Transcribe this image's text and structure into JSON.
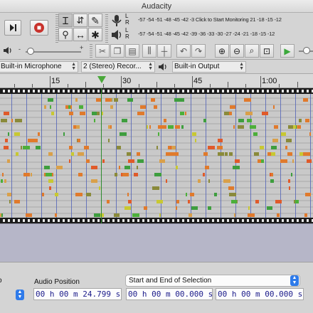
{
  "window": {
    "title": "Audacity"
  },
  "transport": {
    "skip_end_icon": "skip-to-end-icon",
    "record_icon": "record-icon"
  },
  "tools": [
    "selection-tool-icon",
    "envelope-tool-icon",
    "draw-tool-icon",
    "zoom-tool-icon",
    "time-shift-tool-icon",
    "multi-tool-icon"
  ],
  "meters": {
    "record_scale": "-57 -54 -51 -48 -45 -42 -3 Click to Start Monitoring 21 -18 -15 -12",
    "playback_scale": "-57 -54 -51 -48 -45 -42 -39 -36 -33 -30 -27 -24 -21 -18 -15 -12",
    "left_channel": "L",
    "right_channel": "R"
  },
  "device": {
    "input": "Built-in Microphone",
    "channels": "2 (Stereo) Recor...",
    "output": "Built-in Output"
  },
  "ruler": {
    "labels": [
      "15",
      "30",
      "45",
      "1:00"
    ]
  },
  "status": {
    "audio_position_label": "Audio Position",
    "selection_mode": "Start and End of Selection",
    "audio_position": "00 h 00 m 24.799 s",
    "selection_start": "00 h 00 m 00.000 s",
    "selection_end": "00 h 00 m 00.000 s"
  },
  "colors": {
    "accent": "#2f7bea",
    "track_bg": "#c4c4c4",
    "empty_area": "#b6b6c8",
    "time_text": "#1a1a8a"
  }
}
